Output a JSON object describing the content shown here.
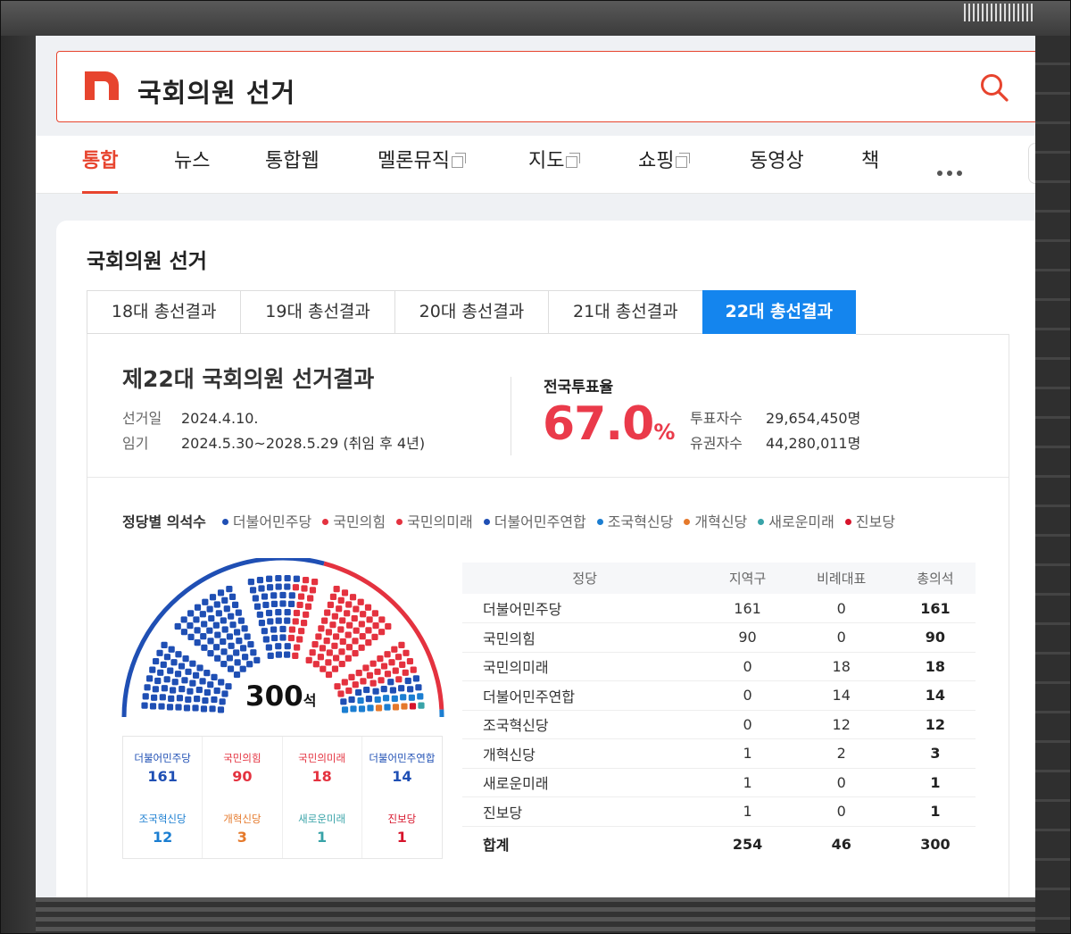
{
  "search": {
    "query": "국회의원 선거"
  },
  "tabs": [
    {
      "label": "통합"
    },
    {
      "label": "뉴스"
    },
    {
      "label": "통합웹"
    },
    {
      "label": "멜론뮤직"
    },
    {
      "label": "지도"
    },
    {
      "label": "쇼핑"
    },
    {
      "label": "동영상"
    },
    {
      "label": "책"
    }
  ],
  "card": {
    "title": "국회의원 선거",
    "election_tabs": [
      "18대 총선결과",
      "19대 총선결과",
      "20대 총선결과",
      "21대 총선결과",
      "22대 총선결과"
    ],
    "result_title": "제22대 국회의원 선거결과",
    "election_day": {
      "label": "선거일",
      "value": "2024.4.10."
    },
    "term": {
      "label": "임기",
      "value": "2024.5.30~2028.5.29 (취임 후 4년)"
    },
    "turnout": {
      "label": "전국투표율",
      "value": "67.0",
      "unit": "%"
    },
    "voters": {
      "label": "투표자수",
      "value": "29,654,450명"
    },
    "electorate": {
      "label": "유권자수",
      "value": "44,280,011명"
    },
    "seats_label": "정당별 의석수",
    "total_seats": {
      "value": "300",
      "unit": "석"
    },
    "parties": [
      {
        "name": "더불어민주당",
        "total": "161",
        "color": "#1f4fb4"
      },
      {
        "name": "국민의힘",
        "total": "90",
        "color": "#e4323f"
      },
      {
        "name": "국민의미래",
        "total": "18",
        "color": "#e4323f"
      },
      {
        "name": "더불어민주연합",
        "total": "14",
        "color": "#1f4fb4"
      },
      {
        "name": "조국혁신당",
        "total": "12",
        "color": "#1b7ed1"
      },
      {
        "name": "개혁신당",
        "total": "3",
        "color": "#e5792b"
      },
      {
        "name": "새로운미래",
        "total": "1",
        "color": "#38a3a8"
      },
      {
        "name": "진보당",
        "total": "1",
        "color": "#d7142b"
      }
    ],
    "table": {
      "headers": [
        "정당",
        "지역구",
        "비례대표",
        "총의석"
      ],
      "rows": [
        [
          "더불어민주당",
          "161",
          "0",
          "161"
        ],
        [
          "국민의힘",
          "90",
          "0",
          "90"
        ],
        [
          "국민의미래",
          "0",
          "18",
          "18"
        ],
        [
          "더불어민주연합",
          "0",
          "14",
          "14"
        ],
        [
          "조국혁신당",
          "0",
          "12",
          "12"
        ],
        [
          "개혁신당",
          "1",
          "2",
          "3"
        ],
        [
          "새로운미래",
          "1",
          "0",
          "1"
        ],
        [
          "진보당",
          "1",
          "0",
          "1"
        ]
      ],
      "sum": [
        "합계",
        "254",
        "46",
        "300"
      ]
    }
  }
}
